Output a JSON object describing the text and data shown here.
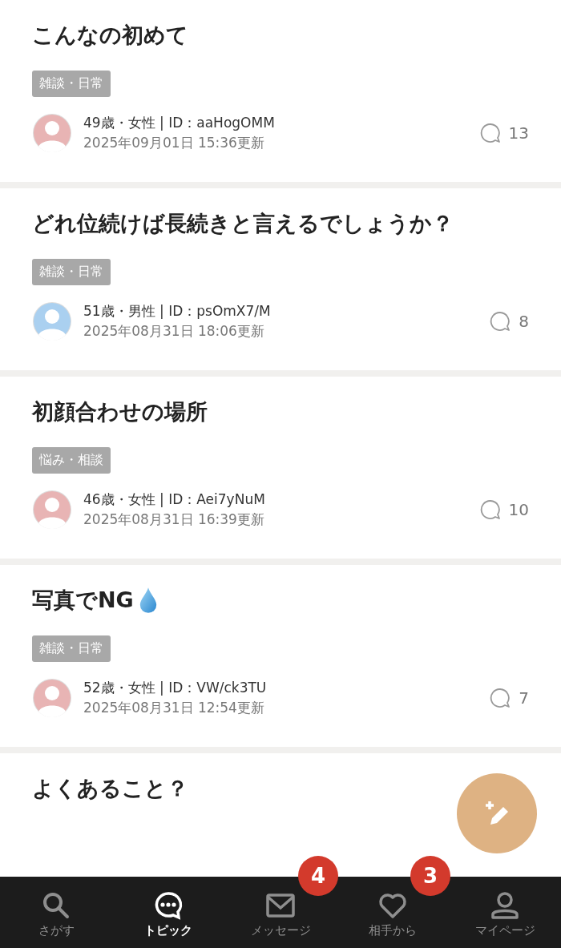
{
  "posts": [
    {
      "title": "こんなの初めて",
      "drop_icon": false,
      "tag": "雑談・日常",
      "author": "49歳・女性 | ID：aaHogOMM",
      "updated": "2025年09月01日 15:36更新",
      "comments": "13",
      "color": "#e8b4b4"
    },
    {
      "title": "どれ位続けば長続きと言えるでしょうか？",
      "drop_icon": false,
      "tag": "雑談・日常",
      "author": "51歳・男性 | ID：psOmX7/M",
      "updated": "2025年08月31日 18:06更新",
      "comments": "8",
      "color": "#aad0f0"
    },
    {
      "title": "初顔合わせの場所",
      "drop_icon": false,
      "tag": "悩み・相談",
      "author": "46歳・女性 | ID：Aei7yNuM",
      "updated": "2025年08月31日 16:39更新",
      "comments": "10",
      "color": "#e8b4b4"
    },
    {
      "title": "写真でNG",
      "drop_icon": true,
      "tag": "雑談・日常",
      "author": "52歳・女性 | ID：VW/ck3TU",
      "updated": "2025年08月31日 12:54更新",
      "comments": "7",
      "color": "#e8b4b4"
    },
    {
      "title": "よくあること？",
      "drop_icon": false
    }
  ],
  "nav": [
    {
      "kind": "search",
      "label": "さがす",
      "selected": false
    },
    {
      "kind": "topic",
      "label": "トピック",
      "selected": true
    },
    {
      "kind": "mail",
      "label": "メッセージ",
      "selected": false,
      "badge": "4"
    },
    {
      "kind": "heart",
      "label": "相手から",
      "selected": false,
      "badge": "3"
    },
    {
      "kind": "person",
      "label": "マイページ",
      "selected": false
    }
  ]
}
